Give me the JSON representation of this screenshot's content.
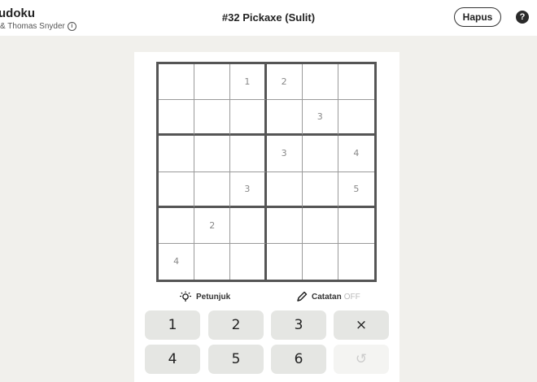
{
  "header": {
    "app_title": "udoku",
    "author": "& Thomas Snyder",
    "puzzle_title": "#32 Pickaxe (Sulit)",
    "clear_label": "Hapus",
    "help_icon": "help-icon",
    "info_icon": "info-icon"
  },
  "board": {
    "size": 6,
    "cells": [
      [
        "",
        "",
        "1",
        "2",
        "",
        ""
      ],
      [
        "",
        "",
        "",
        "",
        "3",
        ""
      ],
      [
        "",
        "",
        "",
        "3",
        "",
        "4"
      ],
      [
        "",
        "",
        "3",
        "",
        "",
        "5"
      ],
      [
        "",
        "2",
        "",
        "",
        "",
        ""
      ],
      [
        "4",
        "",
        "",
        "",
        "",
        ""
      ]
    ]
  },
  "tools": {
    "hint_label": "Petunjuk",
    "notes_label": "Catatan",
    "notes_state": "OFF"
  },
  "keypad": {
    "keys": [
      "1",
      "2",
      "3",
      "×",
      "4",
      "5",
      "6",
      "↺"
    ]
  },
  "colors": {
    "background": "#f1f0ec",
    "key_background": "#e5e6e3",
    "given_digit": "#888888",
    "grid_line": "#555555"
  }
}
